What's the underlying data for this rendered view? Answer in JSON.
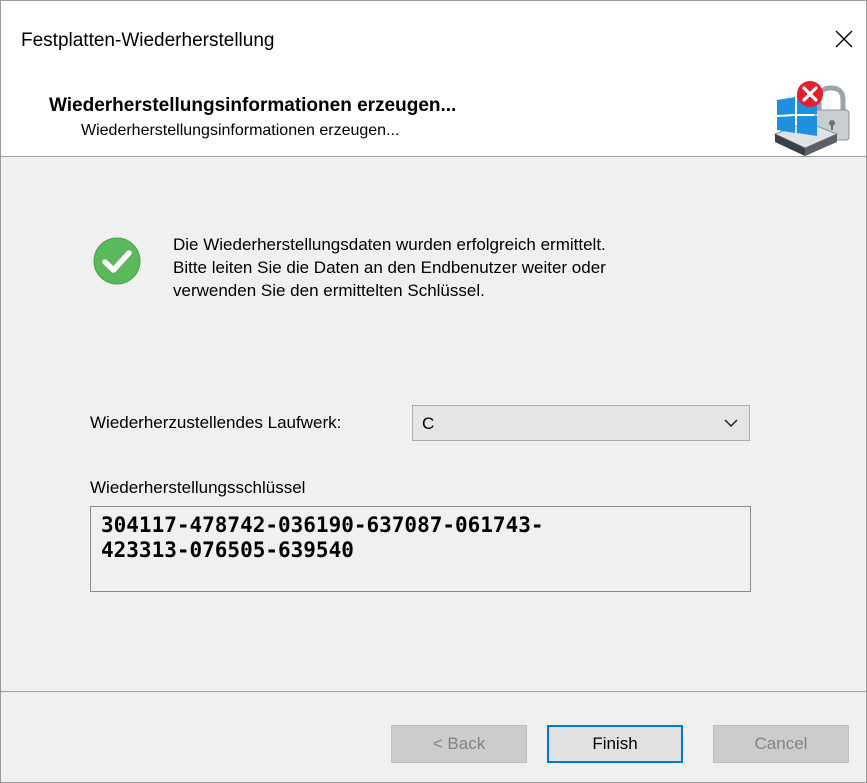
{
  "window": {
    "title": "Festplatten-Wiederherstellung"
  },
  "header": {
    "title": "Wiederherstellungsinformationen erzeugen...",
    "subtitle": "Wiederherstellungsinformationen erzeugen...",
    "icon": "windows-disk-lock-error-icon"
  },
  "status": {
    "icon": "success-check-icon",
    "lines": [
      "Die Wiederherstellungsdaten wurden erfolgreich ermittelt.",
      "Bitte leiten Sie die Daten an den Endbenutzer weiter oder",
      "verwenden Sie den ermittelten Schlüssel."
    ]
  },
  "drive": {
    "label": "Wiederherzustellendes Laufwerk:",
    "selected": "C"
  },
  "key": {
    "label": "Wiederherstellungsschlüssel",
    "lines": [
      "304117-478742-036190-637087-061743-",
      "423313-076505-639540"
    ]
  },
  "buttons": {
    "back": "< Back",
    "finish": "Finish",
    "cancel": "Cancel"
  },
  "colors": {
    "accent": "#0078d7",
    "success": "#5cb85c",
    "error": "#e01e2e"
  }
}
